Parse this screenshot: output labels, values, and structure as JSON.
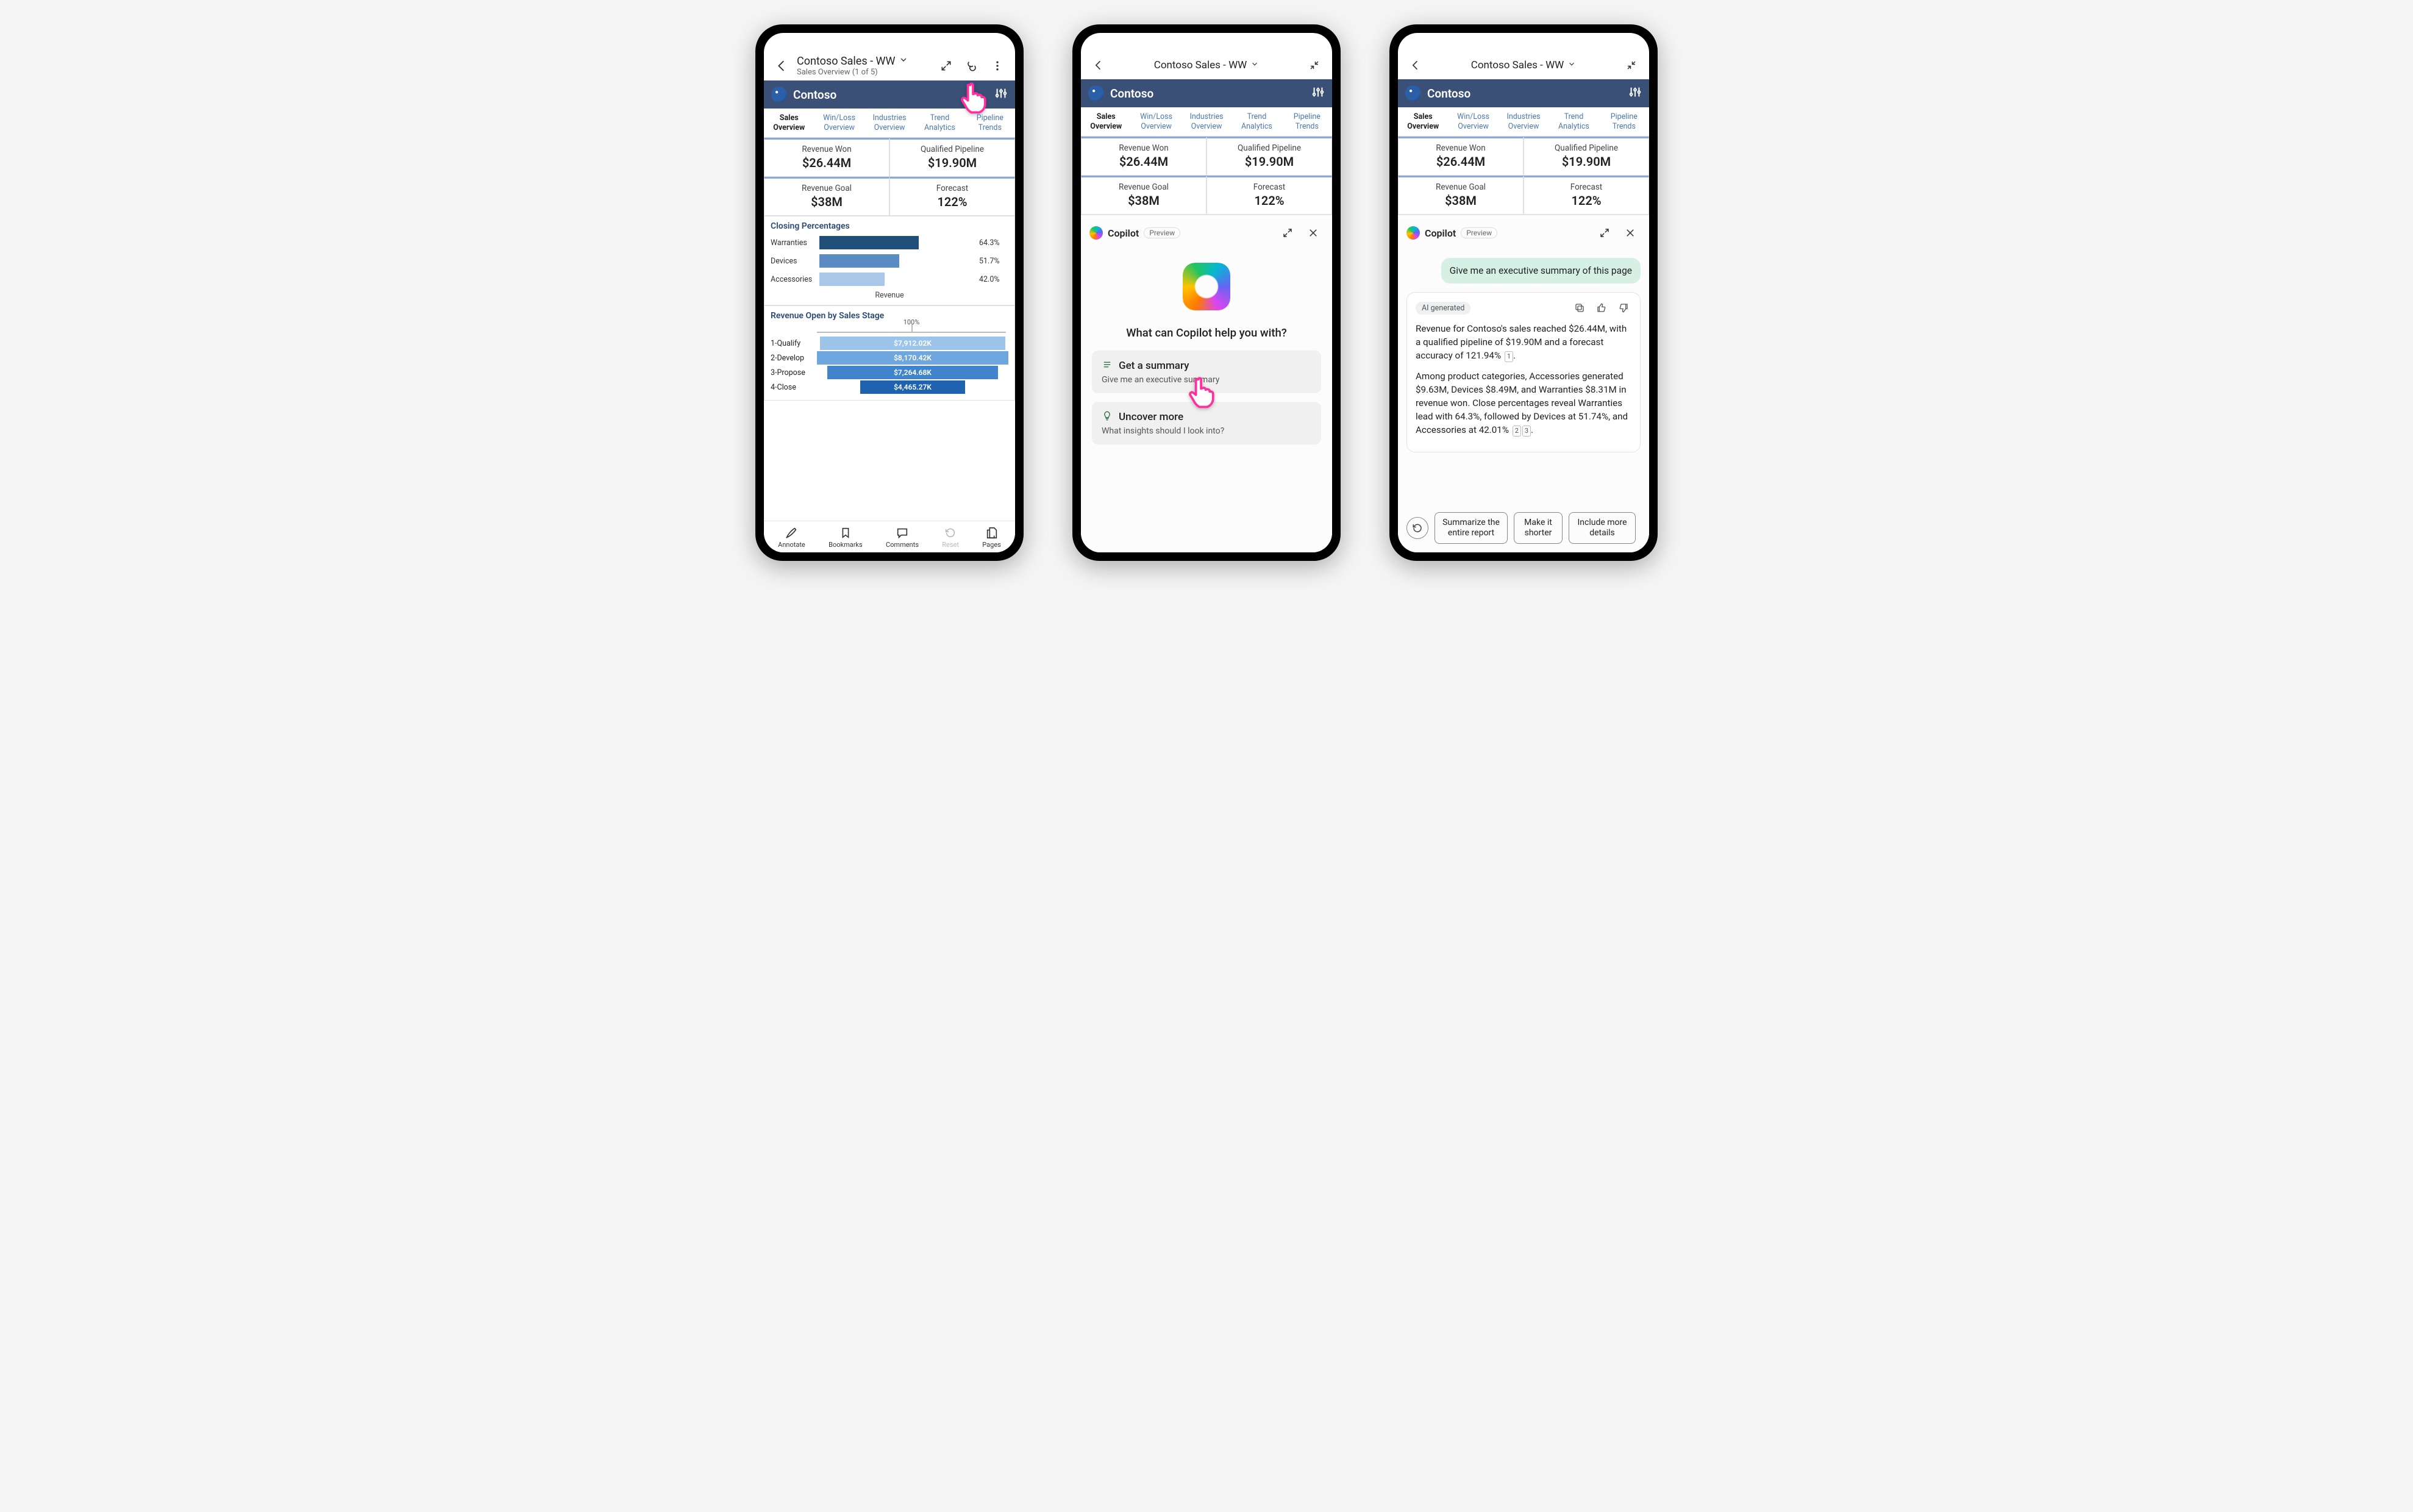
{
  "report": {
    "title": "Contoso Sales - WW",
    "subtitle": "Sales Overview (1 of 5)",
    "brand": "Contoso",
    "tabs": [
      {
        "label": "Sales\nOverview",
        "active": true
      },
      {
        "label": "Win/Loss\nOverview"
      },
      {
        "label": "Industries\nOverview"
      },
      {
        "label": "Trend\nAnalytics"
      },
      {
        "label": "Pipeline\nTrends"
      }
    ],
    "kpis": [
      {
        "label": "Revenue Won",
        "value": "$26.44M"
      },
      {
        "label": "Qualified Pipeline",
        "value": "$19.90M"
      },
      {
        "label": "Revenue Goal",
        "value": "$38M"
      },
      {
        "label": "Forecast",
        "value": "122%"
      }
    ]
  },
  "chart_data": [
    {
      "type": "bar",
      "orientation": "horizontal",
      "title": "Closing Percentages",
      "xlabel": "Revenue",
      "categories": [
        "Warranties",
        "Devices",
        "Accessories"
      ],
      "values": [
        64.3,
        51.7,
        42.0
      ],
      "value_labels": [
        "64.3%",
        "51.7%",
        "42.0%"
      ],
      "colors": [
        "#1f4e79",
        "#5a8bc2",
        "#a9c7e8"
      ],
      "xlim": [
        0,
        100
      ]
    },
    {
      "type": "bar",
      "orientation": "horizontal",
      "title": "Revenue Open by Sales Stage",
      "scale_label": "100%",
      "categories": [
        "1-Qualify",
        "2-Develop",
        "3-Propose",
        "4-Close"
      ],
      "values": [
        7912.02,
        8170.42,
        7264.68,
        4465.27
      ],
      "value_labels": [
        "$7,912.02K",
        "$8,170.42K",
        "$7,264.68K",
        "$4,465.27K"
      ],
      "colors": [
        "#9cc3ea",
        "#6fa6dd",
        "#3f84cc",
        "#1f63b0"
      ],
      "max": 8170.42
    }
  ],
  "bottombar": {
    "annotate": "Annotate",
    "bookmarks": "Bookmarks",
    "comments": "Comments",
    "reset": "Reset",
    "pages": "Pages"
  },
  "copilot": {
    "title": "Copilot",
    "preview": "Preview",
    "question": "What can Copilot help you with?",
    "suggestions": [
      {
        "title": "Get a summary",
        "sub": "Give me an executive summary",
        "icon": "list"
      },
      {
        "title": "Uncover more",
        "sub": "What insights should I look into?",
        "icon": "bulb"
      }
    ]
  },
  "chat": {
    "user": "Give me an executive summary of this page",
    "ai_badge": "AI generated",
    "para1_a": "Revenue for Contoso's sales reached $26.44M, with a qualified pipeline of $19.90M and a forecast accuracy of 121.94% ",
    "para1_cite": "1",
    "para1_b": ".",
    "para2_a": "Among product categories, Accessories generated $9.63M, Devices $8.49M, and Warranties $8.31M in revenue won. Close percentages reveal Warranties lead with 64.3%, followed by Devices at 51.74%, and Accessories at 42.01% ",
    "para2_cite1": "2",
    "para2_cite2": "3",
    "para2_b": ".",
    "chips": [
      "Summarize the entire report",
      "Make it shorter",
      "Include more details"
    ]
  }
}
